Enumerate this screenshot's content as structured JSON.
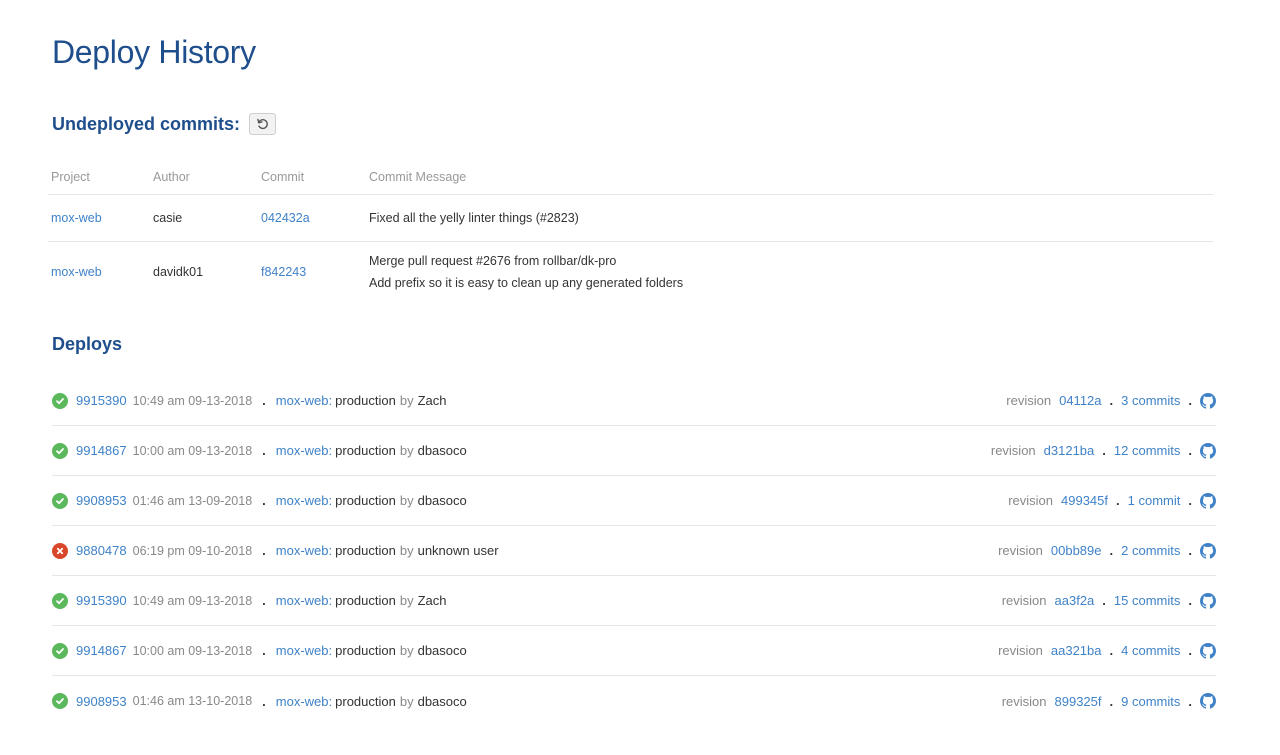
{
  "page": {
    "title": "Deploy History"
  },
  "undeployed": {
    "title": "Undeployed commits:",
    "headers": {
      "project": "Project",
      "author": "Author",
      "commit": "Commit",
      "message": "Commit Message"
    },
    "rows": [
      {
        "project": "mox-web",
        "author": "casie",
        "commit": "042432a",
        "message": "Fixed all the yelly linter things (#2823)",
        "message2": ""
      },
      {
        "project": "mox-web",
        "author": "davidk01",
        "commit": "f842243",
        "message": "Merge pull request #2676 from rollbar/dk-pro",
        "message2": "Add prefix so it is easy to clean up any generated folders"
      }
    ]
  },
  "deploys": {
    "title": "Deploys",
    "by_label": "by",
    "revision_label": "revision",
    "separator": ".",
    "rows": [
      {
        "status": "success",
        "id": "9915390",
        "time": "10:49 am 09-13-2018",
        "project": "mox-web:",
        "env": "production",
        "user": "Zach",
        "revision": "04112a",
        "commits": "3 commits"
      },
      {
        "status": "success",
        "id": "9914867",
        "time": "10:00 am 09-13-2018",
        "project": "mox-web:",
        "env": "production",
        "user": "dbasoco",
        "revision": "d3121ba",
        "commits": "12 commits"
      },
      {
        "status": "success",
        "id": "9908953",
        "time": "01:46 am 13-09-2018",
        "project": "mox-web:",
        "env": "production",
        "user": "dbasoco",
        "revision": "499345f",
        "commits": "1 commit"
      },
      {
        "status": "failed",
        "id": "9880478",
        "time": "06:19 pm 09-10-2018",
        "project": "mox-web:",
        "env": "production",
        "user": "unknown user",
        "revision": "00bb89e",
        "commits": "2 commits"
      },
      {
        "status": "success",
        "id": "9915390",
        "time": "10:49 am 09-13-2018",
        "project": "mox-web:",
        "env": "production",
        "user": "Zach",
        "revision": "aa3f2a",
        "commits": "15 commits"
      },
      {
        "status": "success",
        "id": "9914867",
        "time": "10:00 am 09-13-2018",
        "project": "mox-web:",
        "env": "production",
        "user": "dbasoco",
        "revision": "aa321ba",
        "commits": "4 commits"
      },
      {
        "status": "success",
        "id": "9908953",
        "time": "01:46 am 13-10-2018",
        "project": "mox-web:",
        "env": "production",
        "user": "dbasoco",
        "revision": "899325f",
        "commits": "9 commits"
      }
    ]
  },
  "colors": {
    "title": "#1f4e8c",
    "link": "#3f82c8",
    "success": "#5cb85c",
    "failed": "#d9472b"
  },
  "icons": {
    "refresh": "refresh-icon",
    "success": "check-circle-icon",
    "failed": "x-circle-icon",
    "github": "github-icon"
  }
}
